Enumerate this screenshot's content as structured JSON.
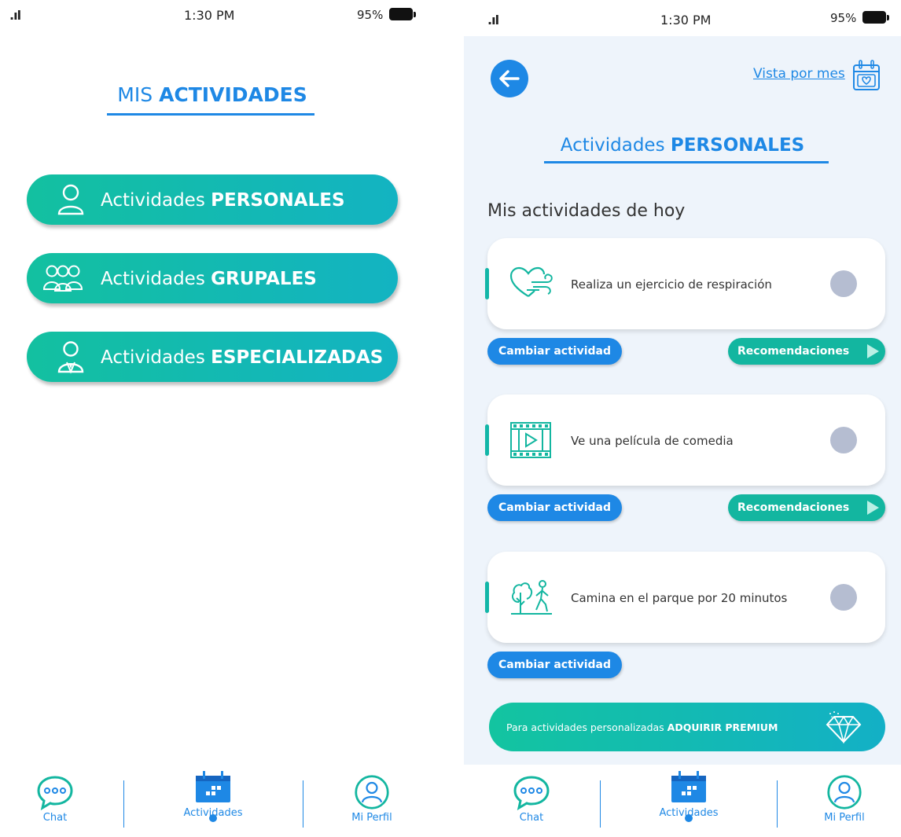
{
  "left": {
    "status": {
      "time": "1:30 PM",
      "battery": "95%"
    },
    "title": {
      "normal": "MIS ",
      "bold": "ACTIVIDADES"
    },
    "menu": [
      {
        "normal": "Actividades ",
        "bold": "PERSONALES",
        "icon": "person-icon"
      },
      {
        "normal": "Actividades ",
        "bold": "GRUPALES",
        "icon": "group-icon"
      },
      {
        "normal": "Actividades ",
        "bold": "ESPECIALIZADAS",
        "icon": "specialist-icon"
      }
    ],
    "nav": {
      "chat": "Chat",
      "actividades": "Actividades",
      "perfil": "Mi Perfil"
    }
  },
  "right": {
    "status": {
      "time": "1:30 PM",
      "battery": "95%"
    },
    "month_link": "Vista por mes",
    "title": {
      "normal": "Actividades ",
      "bold": "PERSONALES"
    },
    "section_title": "Mis actividades de hoy",
    "activities": [
      {
        "text": "Realiza un ejercicio de respiración",
        "icon": "breathing-heart-icon",
        "change": "Cambiar actividad",
        "recommend": "Recomendaciones"
      },
      {
        "text": "Ve una película de comedia",
        "icon": "film-icon",
        "change": "Cambiar actividad",
        "recommend": "Recomendaciones"
      },
      {
        "text": "Camina en el parque por 20 minutos",
        "icon": "walk-park-icon",
        "change": "Cambiar actividad"
      }
    ],
    "premium": {
      "normal": "Para actividades personalizadas ",
      "bold": "ADQUIRIR PREMIUM"
    },
    "nav": {
      "chat": "Chat",
      "actividades": "Actividades",
      "perfil": "Mi Perfil"
    }
  },
  "colors": {
    "primary_blue": "#1e88e5",
    "teal": "#13b6a0",
    "check_gray": "#b5bdd1",
    "background": "#eef4fb"
  }
}
